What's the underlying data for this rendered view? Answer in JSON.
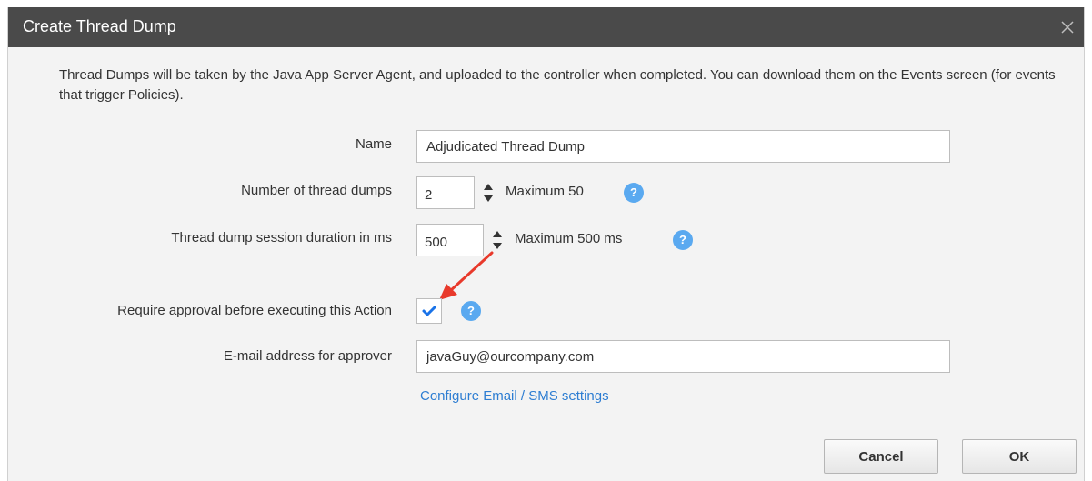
{
  "dialog": {
    "title": "Create Thread Dump",
    "close_icon": "close-icon",
    "description": "Thread Dumps will be taken by the Java App Server Agent, and uploaded to the controller when completed.  You can download them on the Events screen (for events that trigger Policies)."
  },
  "form": {
    "name": {
      "label": "Name",
      "value": "Adjudicated Thread Dump"
    },
    "num_dumps": {
      "label": "Number of thread dumps",
      "value": "2",
      "hint": "Maximum 50",
      "help": "?"
    },
    "duration": {
      "label": "Thread dump session duration in ms",
      "value": "500",
      "hint": "Maximum 500 ms",
      "help": "?"
    },
    "require_approval": {
      "label": "Require approval before executing this Action",
      "checked": true,
      "help": "?"
    },
    "approver_email": {
      "label": "E-mail address for approver",
      "value": "javaGuy@ourcompany.com"
    },
    "configure_link": "Configure Email / SMS settings"
  },
  "buttons": {
    "cancel": "Cancel",
    "ok": "OK"
  },
  "colors": {
    "titlebar": "#4a4a4a",
    "help": "#5aa9f0",
    "link": "#2d7dd2",
    "checkmark": "#1a73e8",
    "annotation_arrow": "#e8392b"
  }
}
